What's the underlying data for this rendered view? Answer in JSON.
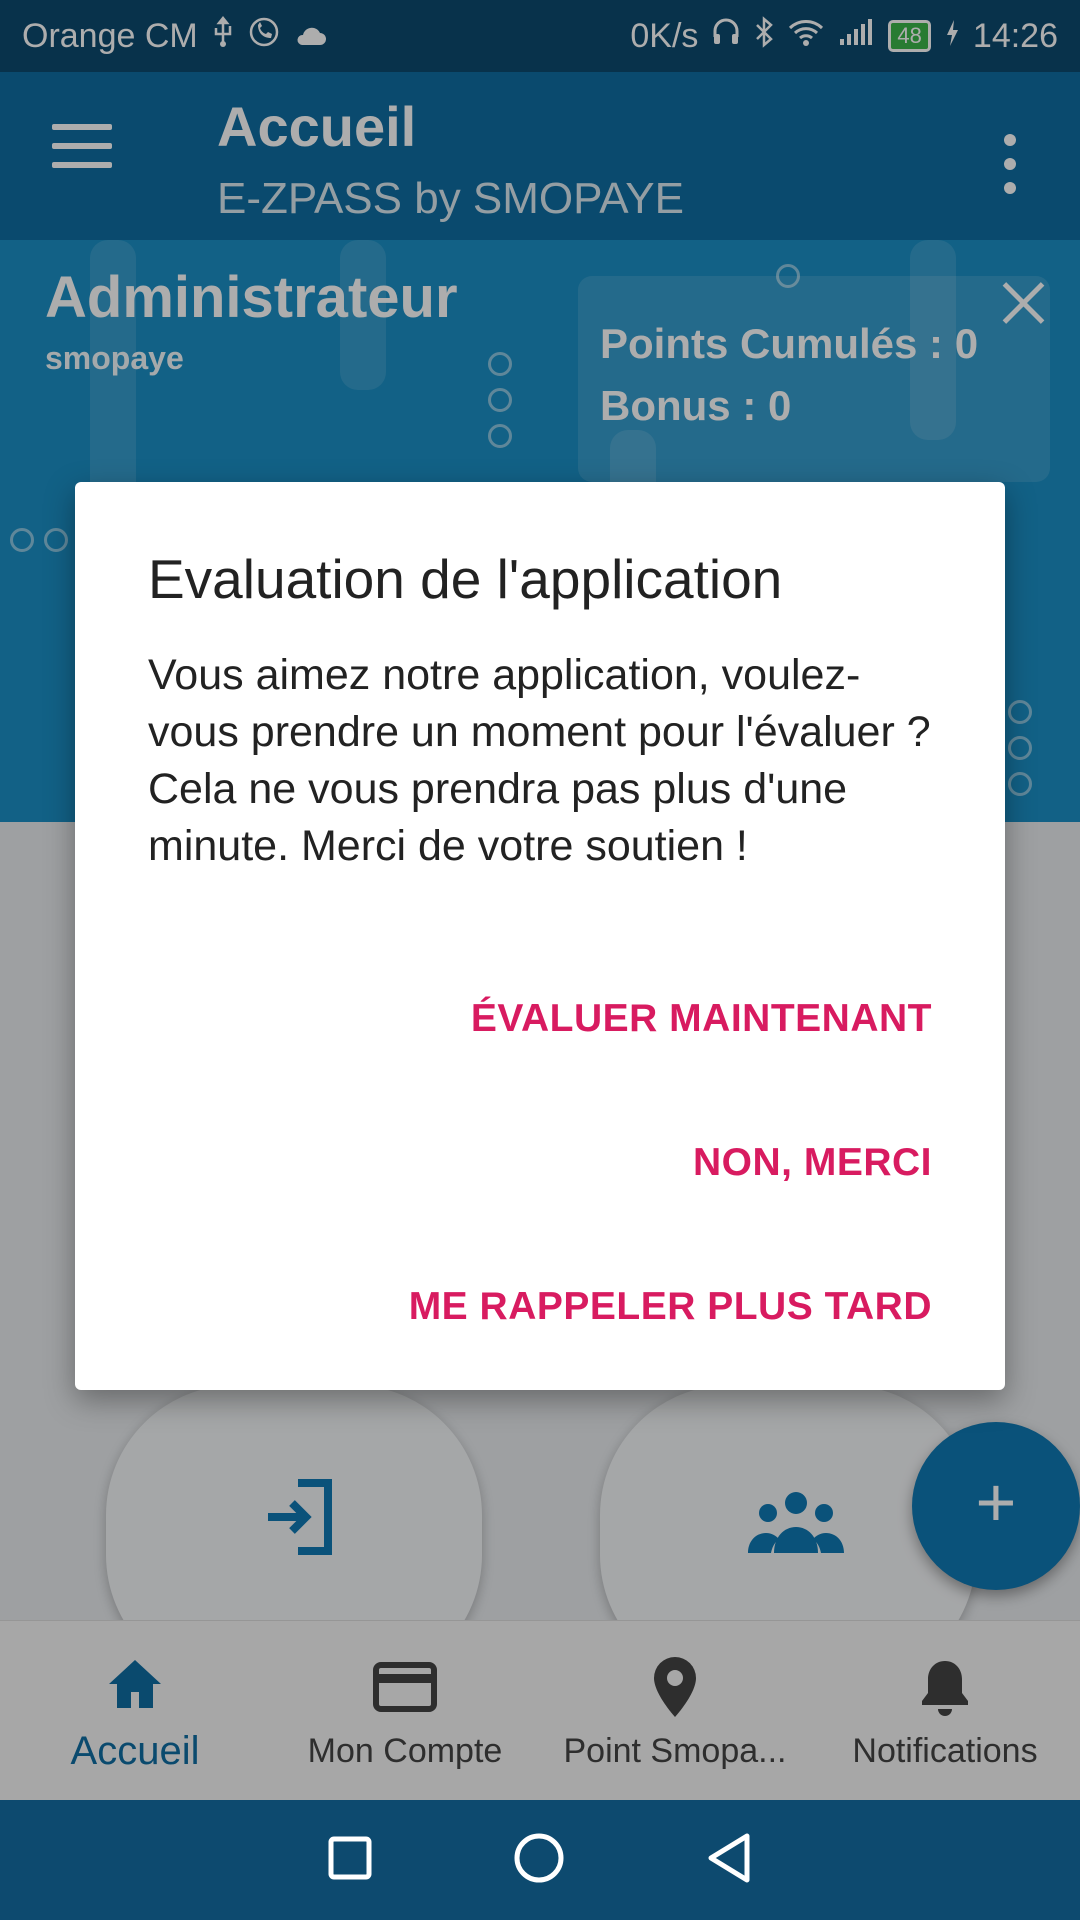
{
  "status_bar": {
    "carrier": "Orange CM",
    "network_speed": "0K/s",
    "battery": "48",
    "time": "14:26"
  },
  "app_bar": {
    "title": "Accueil",
    "subtitle": "E-ZPASS by SMOPAYE"
  },
  "header": {
    "role": "Administrateur",
    "username": "smopaye",
    "points_label": "Points Cumulés : 0",
    "bonus_label": "Bonus : 0"
  },
  "dialog": {
    "title": "Evaluation de l'application",
    "message": "Vous aimez notre application, voulez-vous prendre un moment pour l'évaluer ? Cela ne vous prendra pas plus d'une minute. Merci de votre soutien !",
    "btn_rate": "ÉVALUER MAINTENANT",
    "btn_no": "NON, MERCI",
    "btn_later": "ME RAPPELER PLUS TARD"
  },
  "fab": {
    "label": "+"
  },
  "bottom_nav": [
    {
      "label": "Accueil",
      "icon": "home-icon",
      "active": true
    },
    {
      "label": "Mon Compte",
      "icon": "card-icon",
      "active": false
    },
    {
      "label": "Point Smopa...",
      "icon": "location-pin-icon",
      "active": false
    },
    {
      "label": "Notifications",
      "icon": "bell-icon",
      "active": false
    }
  ],
  "colors": {
    "primary": "#0f6ea3",
    "header": "#1b90c6",
    "accent": "#d81b60",
    "system_bar": "#0d4a6f"
  }
}
